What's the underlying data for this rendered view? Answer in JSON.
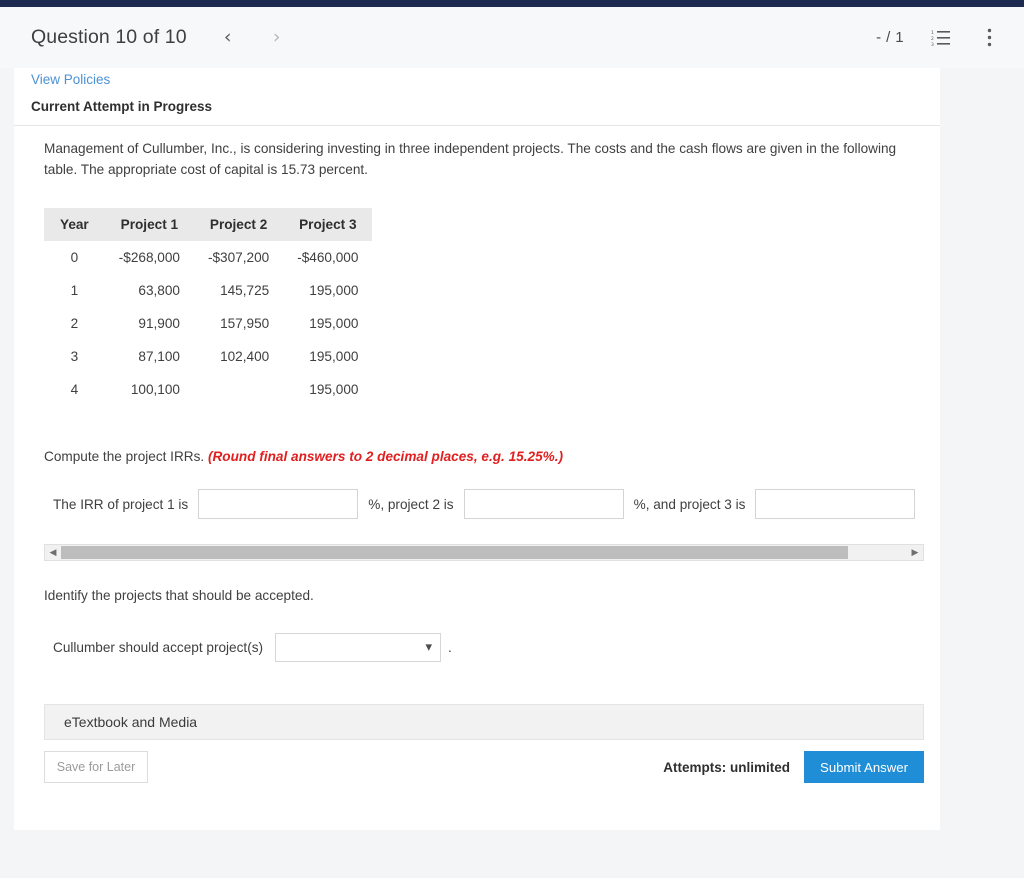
{
  "header": {
    "title": "Question 10 of 10",
    "prev_icon": "chevron-left-icon",
    "next_icon": "chevron-right-icon",
    "score": "- / 1",
    "list_icon": "numbered-list-icon",
    "more_icon": "more-vertical-icon"
  },
  "card": {
    "view_policies": "View Policies",
    "attempt_status": "Current Attempt in Progress",
    "prompt": "Management of Cullumber, Inc., is considering investing in three independent projects. The costs and the cash flows are given in the following table. The appropriate cost of capital is 15.73 percent.",
    "compute_label": "Compute the project IRRs.",
    "round_note": "(Round final answers to 2 decimal places, e.g. 15.25%.)",
    "identify_label": "Identify the projects that should be accepted."
  },
  "table": {
    "columns": [
      "Year",
      "Project 1",
      "Project 2",
      "Project 3"
    ],
    "rows": [
      [
        "0",
        "-$268,000",
        "-$307,200",
        "-$460,000"
      ],
      [
        "1",
        "63,800",
        "145,725",
        "195,000"
      ],
      [
        "2",
        "91,900",
        "157,950",
        "195,000"
      ],
      [
        "3",
        "87,100",
        "102,400",
        "195,000"
      ],
      [
        "4",
        "100,100",
        "",
        "195,000"
      ]
    ]
  },
  "answers": {
    "label_1": "The IRR of project 1 is",
    "value_1": "",
    "label_2": "%, project 2 is",
    "value_2": "",
    "label_3": "%, and project 3 is",
    "value_3": "",
    "scroll_left_icon": "scroll-left-arrow-icon",
    "scroll_right_icon": "scroll-right-arrow-icon"
  },
  "accept": {
    "label": "Cullumber should accept project(s)",
    "selected": "",
    "caret_icon": "chevron-down-icon",
    "period": "."
  },
  "footer": {
    "etextbook": "eTextbook and Media",
    "save_label": "Save for Later",
    "attempts": "Attempts: unlimited",
    "submit_label": "Submit Answer"
  },
  "colors": {
    "navy": "#1b2a4e",
    "link": "#4b92d4",
    "accent_red": "#e02020",
    "submit_blue": "#1f8ed6",
    "table_header": "#e9e9e9"
  }
}
